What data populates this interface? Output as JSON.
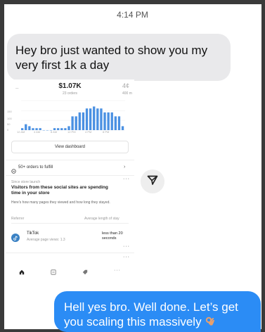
{
  "status_bar": {
    "time": "4:14 PM"
  },
  "messages": {
    "incoming": "Hey bro just wanted to show you my very first 1k a day",
    "outgoing": "Hell yes bro. Well done. Let’s get you scaling this massively"
  },
  "screenshot": {
    "stat_dash": "–",
    "stat_value": "$1.07K",
    "stat_sub": "23 orders",
    "stat_next": "4¢",
    "stat_next_sub": "400 m",
    "chart_data": {
      "type": "bar",
      "values": [
        1,
        3,
        2,
        1,
        1,
        1,
        0,
        0,
        0,
        1,
        1,
        1,
        1,
        2,
        7,
        7,
        9,
        9,
        11,
        11,
        12,
        11,
        11,
        9,
        9,
        9,
        7,
        7,
        2
      ],
      "ylim": [
        0,
        15
      ],
      "y_ticks": [
        "150",
        "100",
        "50",
        "0"
      ],
      "x_ticks": [
        "12 AM",
        "4 AM",
        "8 AM",
        "12 PM",
        "4 PM",
        "8 PM"
      ],
      "bar_color": "#4a90e2"
    },
    "view_dashboard": "View dashboard",
    "orders_to_fulfill": "50+ orders to fulfill",
    "since_launch": "Since store launch",
    "visitors_title": "Visitors from these social sites are spending time in your store",
    "visitors_desc": "Here's how many pages they viewed and how long they stayed.",
    "referrer_label": "Referrer",
    "avg_length_label": "Average length of stay",
    "tiktok_name": "TikTok",
    "tiktok_views": "Average page views: 1.3",
    "tiktok_length": "less than 20 seconds"
  },
  "colors": {
    "incoming_bubble": "#e9e9eb",
    "outgoing_bubble": "#2b8cf5"
  }
}
